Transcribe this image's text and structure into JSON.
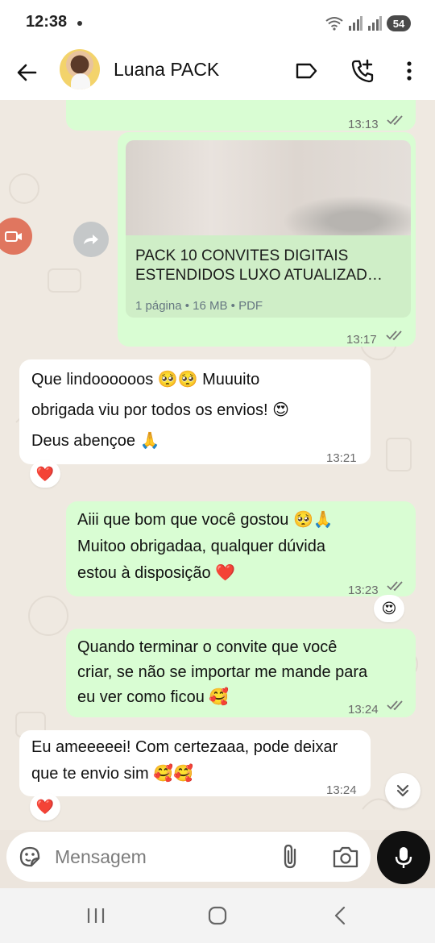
{
  "status_bar": {
    "time": "12:38",
    "battery": "54"
  },
  "header": {
    "contact_name": "Luana PACK"
  },
  "messages": [
    {
      "time": "13:13"
    },
    {
      "document": {
        "title_line1": "PACK 10 CONVITES DIGITAIS",
        "title_line2": "ESTENDIDOS LUXO ATUALIZAD…",
        "meta": "1 página • 16 MB • PDF"
      },
      "time": "13:17"
    },
    {
      "line1": "Que lindoooooos 🥺🥺 Muuuito",
      "line2": "obrigada viu por todos os envios! 😍",
      "line3": "Deus abençoe 🙏",
      "time": "13:21",
      "reaction": "❤️"
    },
    {
      "line1": "Aiii que bom que você gostou 🥺🙏",
      "line2": "Muitoo obrigadaa, qualquer dúvida",
      "line3": "estou à disposição ❤️",
      "time": "13:23",
      "reaction": "😍"
    },
    {
      "line1": "Quando terminar o convite que você",
      "line2": "criar, se não se importar me mande para",
      "line3": "eu ver como ficou 🥰",
      "time": "13:24"
    },
    {
      "line1": "Eu ameeeeei! Com certezaaa, pode deixar",
      "line2": "que te envio sim 🥰🥰",
      "time": "13:24",
      "reaction": "❤️"
    }
  ],
  "composer": {
    "placeholder": "Mensagem"
  },
  "colors": {
    "outgoing_bubble": "#d9fdd3",
    "incoming_bubble": "#ffffff",
    "mic_button": "#101010"
  }
}
